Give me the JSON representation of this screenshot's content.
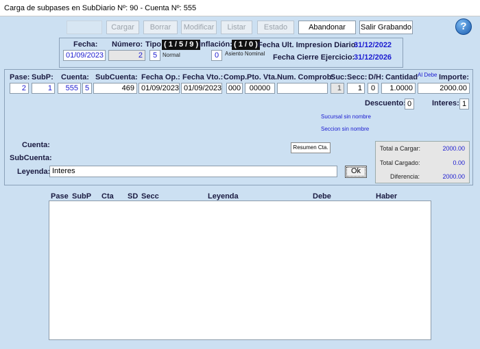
{
  "window": {
    "title": "Carga de subpases en SubDiario Nº: 90 - Cuenta Nº: 555"
  },
  "toolbar": {
    "cargar": "Cargar",
    "borrar": "Borrar",
    "modificar": "Modificar",
    "listar": "Listar",
    "estado": "Estado",
    "abandonar": "Abandonar",
    "salir_grabando": "Salir Grabando"
  },
  "help": {
    "glyph": "?"
  },
  "header": {
    "fecha_label": "Fecha:",
    "fecha_value": "01/09/2023",
    "numero_label": "Número:",
    "numero_value": "2",
    "tipo_label": "Tipo:",
    "tipo_code": "( 1 / 5 / 9 )",
    "tipo_value": "5",
    "tipo_desc": "Normal",
    "inflacion_label": "Inflación:",
    "inflacion_code": "( 1 / 0 )",
    "inflacion_value": "0",
    "inflacion_desc": "Asiento Nominal",
    "fecha_ult_label": "Fecha Ult. Impresion Diario:",
    "fecha_ult_value": "31/12/2022",
    "fecha_cierre_label": "Fecha Cierre Ejercicio:",
    "fecha_cierre_value": "31/12/2026"
  },
  "entry": {
    "labels": {
      "pase": "Pase:",
      "subp": "SubP:",
      "cuenta": "Cuenta:",
      "subcuenta": "SubCuenta:",
      "fecha_op": "Fecha Op.:",
      "fecha_vto": "Fecha Vto.:",
      "comp": "Comp.",
      "pto_vta": "Pto. Vta.",
      "num_comprob": "Num. Comprob:",
      "suc": "Suc:",
      "secc": "Secc:",
      "dh": "D/H:",
      "cantidad": "Cantidad",
      "al_debe": "Al Debe",
      "importe": "Importe:"
    },
    "values": {
      "pase": "2",
      "subp": "1",
      "cuenta": "555",
      "cuenta_sd": "5",
      "subcuenta": "469",
      "fecha_op": "01/09/2023",
      "fecha_vto": "01/09/2023",
      "comp": "000",
      "pto_vta": "00000",
      "num_comprob": "",
      "suc": "1",
      "secc": "1",
      "dh": "0",
      "cantidad": "1.0000",
      "importe": "2000.00"
    },
    "descuento_label": "Descuento:",
    "descuento_value": "0",
    "intereses_label": "Interes:",
    "intereses_value": "1",
    "sucursal_info": "Sucursal sin nombre",
    "seccion_info": "Seccion sin nombre",
    "cuenta_label": "Cuenta:",
    "subcuenta_label": "SubCuenta:",
    "leyenda_label": "Leyenda:",
    "leyenda_value": "Interes",
    "resumen_btn": "Resumen Cta.",
    "ok_btn": "Ok"
  },
  "totals": {
    "total_cargar_label": "Total a Cargar:",
    "total_cargar_value": "2000.00",
    "total_cargado_label": "Total Cargado:",
    "total_cargado_value": "0.00",
    "diferencia_label": "Diferencia:",
    "diferencia_value": "2000.00"
  },
  "grid": {
    "headers": [
      "Pase",
      "SubP",
      "Cta",
      "SD",
      "Secc",
      "Leyenda",
      "Debe",
      "Haber"
    ]
  }
}
